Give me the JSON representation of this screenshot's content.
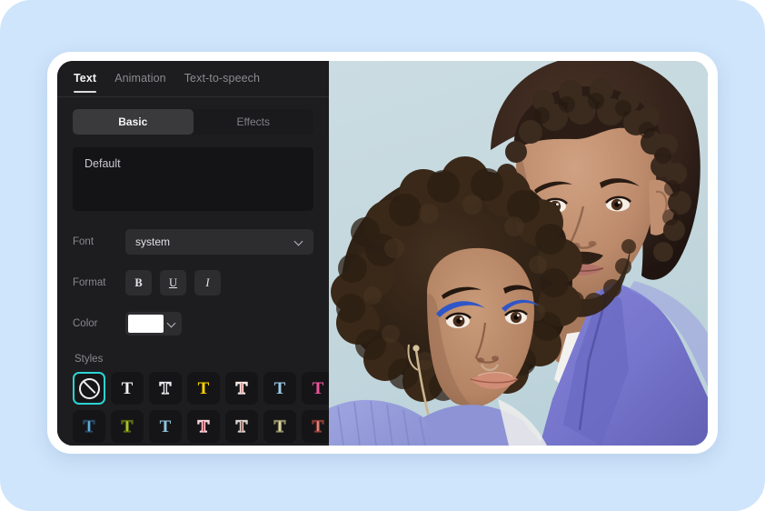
{
  "app": {
    "panel_background": "#1d1d1f",
    "accent_selected": "#2ad4d4"
  },
  "tabs": [
    {
      "label": "Text",
      "active": true
    },
    {
      "label": "Animation",
      "active": false
    },
    {
      "label": "Text-to-speech",
      "active": false
    }
  ],
  "segmented": [
    {
      "label": "Basic",
      "active": true
    },
    {
      "label": "Effects",
      "active": false
    }
  ],
  "text_area": {
    "value": "Default"
  },
  "font_row": {
    "label": "Font",
    "value": "system",
    "chevron_icon": "chevron-down-icon"
  },
  "format_row": {
    "label": "Format",
    "buttons": [
      {
        "name": "bold",
        "glyph": "B"
      },
      {
        "name": "underline",
        "glyph": "U"
      },
      {
        "name": "italic",
        "glyph": "I"
      }
    ]
  },
  "color_row": {
    "label": "Color",
    "value": "#ffffff",
    "chevron_icon": "chevron-down-icon"
  },
  "styles": {
    "label": "Styles",
    "items": [
      {
        "name": "none",
        "icon": "no-style-icon",
        "selected": true,
        "fill": "",
        "stroke": ""
      },
      {
        "name": "style-1",
        "glyph": "T",
        "selected": false,
        "fill": "#f2f2f4",
        "stroke": ""
      },
      {
        "name": "style-2",
        "glyph": "T",
        "selected": false,
        "fill": "#1a1a1c",
        "stroke": "#e8e8ec"
      },
      {
        "name": "style-3",
        "glyph": "T",
        "selected": false,
        "fill": "#ffd400",
        "stroke": ""
      },
      {
        "name": "style-4",
        "glyph": "T",
        "selected": false,
        "fill": "#f4736e",
        "stroke": "#f6e9e4"
      },
      {
        "name": "style-5",
        "glyph": "T",
        "selected": false,
        "fill": "#9dcbe8",
        "stroke": ""
      },
      {
        "name": "style-6",
        "glyph": "T",
        "selected": false,
        "fill": "#f2539c",
        "stroke": ""
      },
      {
        "name": "style-7",
        "glyph": "T",
        "selected": false,
        "fill": "#6ec2f0",
        "stroke": "#2a4a66"
      },
      {
        "name": "style-8",
        "glyph": "T",
        "selected": false,
        "fill": "#c3d63a",
        "stroke": "#5c6a12"
      },
      {
        "name": "style-9",
        "glyph": "T",
        "selected": false,
        "fill": "#8fc4de",
        "stroke": ""
      },
      {
        "name": "style-10",
        "glyph": "T",
        "selected": false,
        "fill": "#f01232",
        "stroke": "#f5d6d9"
      },
      {
        "name": "style-11",
        "glyph": "T",
        "selected": false,
        "fill": "#a5493c",
        "stroke": "#d9d2cd"
      },
      {
        "name": "style-12",
        "glyph": "T",
        "selected": false,
        "fill": "#ece7b4",
        "stroke": "#8d8a63"
      },
      {
        "name": "style-13",
        "glyph": "T",
        "selected": false,
        "fill": "#e8998f",
        "stroke": "#8c3b33"
      }
    ]
  },
  "preview_photo": {
    "description": "Portrait photograph of two people embracing against a pale blue sky; man in a periwinkle blazer, woman with curly hair and blue eyeliner",
    "sky_color": "#c6d9de",
    "blazer_color": "#7a79cf"
  }
}
